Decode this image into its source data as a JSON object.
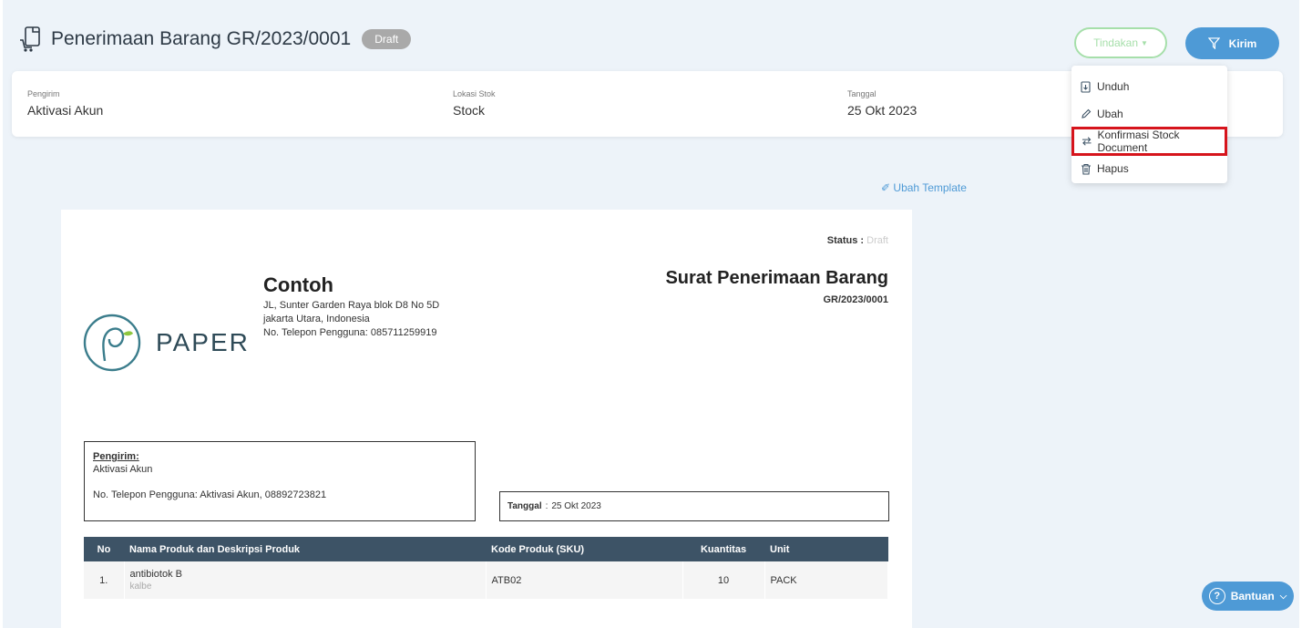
{
  "header": {
    "title": "Penerimaan Barang GR/2023/0001",
    "status_badge": "Draft",
    "actions_button": "Tindakan",
    "send_button": "Kirim"
  },
  "info": {
    "sender": {
      "label": "Pengirim",
      "value": "Aktivasi Akun"
    },
    "location": {
      "label": "Lokasi Stok",
      "value": "Stock"
    },
    "date": {
      "label": "Tanggal",
      "value": "25 Okt 2023"
    }
  },
  "actions_menu": {
    "items": [
      {
        "label": "Unduh",
        "icon": "download-icon"
      },
      {
        "label": "Ubah",
        "icon": "pencil-icon"
      },
      {
        "label": "Konfirmasi Stock Document",
        "icon": "swap-icon"
      },
      {
        "label": "Hapus",
        "icon": "trash-icon"
      }
    ]
  },
  "template_link": "Ubah Template",
  "document": {
    "status_label": "Status :",
    "status_value": "Draft",
    "logo_text": "PAPER",
    "company": {
      "name": "Contoh",
      "address1": "JL, Sunter Garden Raya blok D8 No 5D",
      "address2": "jakarta Utara, Indonesia",
      "phone": "No. Telepon Pengguna: 085711259919"
    },
    "title": "Surat Penerimaan Barang",
    "number": "GR/2023/0001",
    "sender": {
      "label": "Pengirim:",
      "name": "Aktivasi Akun",
      "phone": "No. Telepon Pengguna: Aktivasi Akun, 08892723821"
    },
    "date": {
      "label": "Tanggal",
      "sep": ":",
      "value": "25 Okt 2023"
    },
    "table": {
      "headers": [
        "No",
        "Nama Produk dan Deskripsi Produk",
        "Kode Produk (SKU)",
        "Kuantitas",
        "Unit"
      ],
      "rows": [
        {
          "no": "1.",
          "name": "antibiotok B",
          "desc": "kalbe",
          "sku": "ATB02",
          "qty": "10",
          "unit": "PACK"
        }
      ]
    }
  },
  "help_button": {
    "label": "Bantuan",
    "icon": "question-icon"
  },
  "colors": {
    "primary": "#4e9ad6",
    "success_border": "#a6dfaa",
    "table_header": "#3d5366",
    "highlight": "#d6141c"
  }
}
